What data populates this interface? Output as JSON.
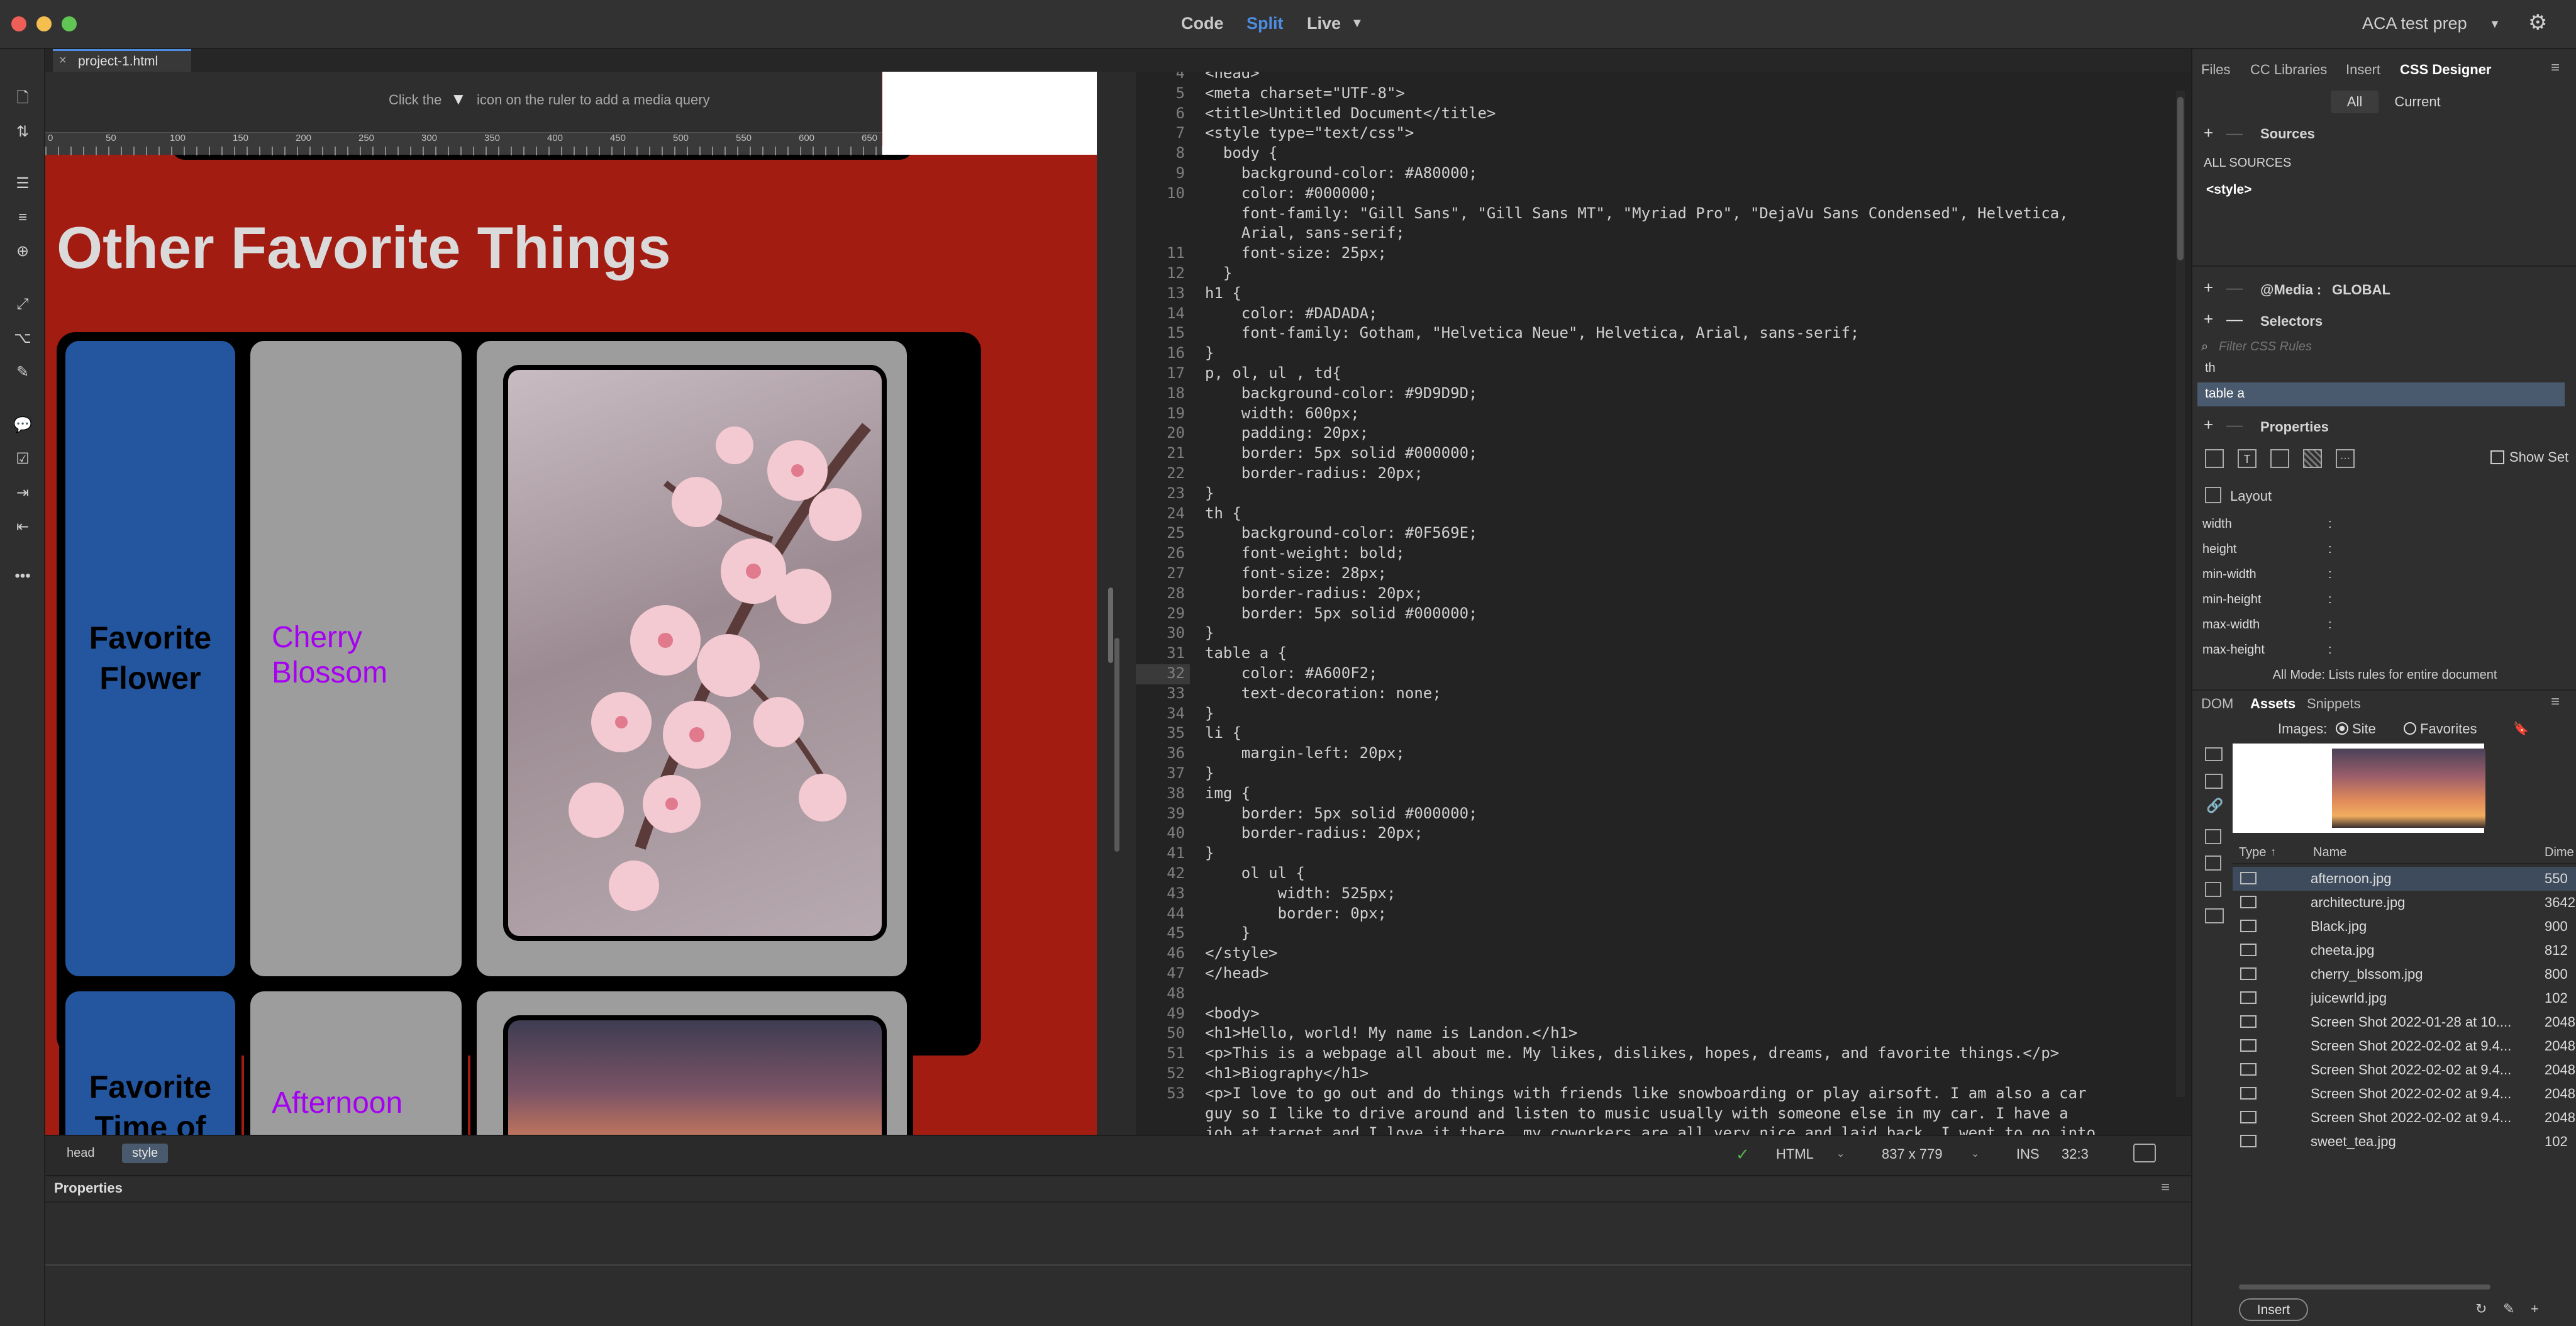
{
  "titlebar": {
    "views": [
      "Code",
      "Split",
      "Live"
    ],
    "active_view": "Split",
    "workspace": "ACA test prep"
  },
  "document_tab": {
    "filename": "project-1.html"
  },
  "design": {
    "media_query_hint_before": "Click the",
    "media_query_hint_after": "icon on the ruler to add a media query",
    "ruler_ticks": [
      "0",
      "50",
      "100",
      "150",
      "200",
      "250",
      "300",
      "350",
      "400",
      "450",
      "500",
      "550",
      "600",
      "650"
    ],
    "heading": "Other Favorite Things",
    "rows": [
      {
        "label": "Favorite Flower",
        "value": "Cherry Blossom"
      },
      {
        "label": "Favorite Time of",
        "value": "Afternoon"
      }
    ]
  },
  "code": {
    "lines": [
      {
        "n": "4",
        "t": "<head>"
      },
      {
        "n": "5",
        "t": "<meta charset=\"UTF-8\">"
      },
      {
        "n": "6",
        "t": "<title>Untitled Document</title>"
      },
      {
        "n": "7",
        "t": "<style type=\"text/css\">"
      },
      {
        "n": "8",
        "t": "  body {"
      },
      {
        "n": "9",
        "t": "    background-color: #A80000;"
      },
      {
        "n": "10",
        "t": "    color: #000000;"
      },
      {
        "n": "",
        "t": "    font-family: \"Gill Sans\", \"Gill Sans MT\", \"Myriad Pro\", \"DejaVu Sans Condensed\", Helvetica,"
      },
      {
        "n": "",
        "t": "    Arial, sans-serif;"
      },
      {
        "n": "11",
        "t": "    font-size: 25px;"
      },
      {
        "n": "12",
        "t": "  }"
      },
      {
        "n": "13",
        "t": "h1 {"
      },
      {
        "n": "14",
        "t": "    color: #DADADA;"
      },
      {
        "n": "15",
        "t": "    font-family: Gotham, \"Helvetica Neue\", Helvetica, Arial, sans-serif;"
      },
      {
        "n": "16",
        "t": "}"
      },
      {
        "n": "17",
        "t": "p, ol, ul , td{"
      },
      {
        "n": "18",
        "t": "    background-color: #9D9D9D;"
      },
      {
        "n": "19",
        "t": "    width: 600px;"
      },
      {
        "n": "20",
        "t": "    padding: 20px;"
      },
      {
        "n": "21",
        "t": "    border: 5px solid #000000;"
      },
      {
        "n": "22",
        "t": "    border-radius: 20px;"
      },
      {
        "n": "23",
        "t": "}"
      },
      {
        "n": "24",
        "t": "th {"
      },
      {
        "n": "25",
        "t": "    background-color: #0F569E;"
      },
      {
        "n": "26",
        "t": "    font-weight: bold;"
      },
      {
        "n": "27",
        "t": "    font-size: 28px;"
      },
      {
        "n": "28",
        "t": "    border-radius: 20px;"
      },
      {
        "n": "29",
        "t": "    border: 5px solid #000000;"
      },
      {
        "n": "30",
        "t": "}"
      },
      {
        "n": "31",
        "t": "table a {"
      },
      {
        "n": "32",
        "t": "    color: #A600F2;"
      },
      {
        "n": "33",
        "t": "    text-decoration: none;"
      },
      {
        "n": "34",
        "t": "}"
      },
      {
        "n": "35",
        "t": "li {"
      },
      {
        "n": "36",
        "t": "    margin-left: 20px;"
      },
      {
        "n": "37",
        "t": "}"
      },
      {
        "n": "38",
        "t": "img {"
      },
      {
        "n": "39",
        "t": "    border: 5px solid #000000;"
      },
      {
        "n": "40",
        "t": "    border-radius: 20px;"
      },
      {
        "n": "41",
        "t": "}"
      },
      {
        "n": "42",
        "t": "    ol ul {"
      },
      {
        "n": "43",
        "t": "        width: 525px;"
      },
      {
        "n": "44",
        "t": "        border: 0px;"
      },
      {
        "n": "45",
        "t": "    }"
      },
      {
        "n": "46",
        "t": "</style>"
      },
      {
        "n": "47",
        "t": "</head>"
      },
      {
        "n": "48",
        "t": ""
      },
      {
        "n": "49",
        "t": "<body>"
      },
      {
        "n": "50",
        "t": "<h1>Hello, world! My name is Landon.</h1>"
      },
      {
        "n": "51",
        "t": "<p>This is a webpage all about me. My likes, dislikes, hopes, dreams, and favorite things.</p>"
      },
      {
        "n": "52",
        "t": "<h1>Biography</h1>"
      },
      {
        "n": "53",
        "t": "<p>I love to go out and do things with friends like snowboarding or play airsoft. I am also a car"
      },
      {
        "n": "",
        "t": "guy so I like to drive around and listen to music usually with someone else in my car. I have a"
      },
      {
        "n": "",
        "t": "job at target and I love it there, my coworkers are all very nice and laid back. I went to go into"
      }
    ],
    "active_line": "32"
  },
  "statusbar": {
    "tags": [
      "head",
      "style"
    ],
    "language": "HTML",
    "dimensions": "837 x 779",
    "mode": "INS",
    "position": "32:3"
  },
  "properties": {
    "title": "Properties"
  },
  "rightpanel": {
    "tabs": [
      "Files",
      "CC Libraries",
      "Insert",
      "CSS Designer"
    ],
    "active_tab": "CSS Designer",
    "toggle": [
      "All",
      "Current"
    ],
    "sources_label": "Sources",
    "sources": [
      "ALL SOURCES",
      "<style>"
    ],
    "media_label": "@Media :",
    "media_value": "GLOBAL",
    "selectors_label": "Selectors",
    "filter_placeholder": "Filter CSS Rules",
    "selectors": [
      "th",
      "table a"
    ],
    "properties_label": "Properties",
    "show_set": "Show Set",
    "layout_label": "Layout",
    "layout_props": [
      "width",
      "height",
      "min-width",
      "min-height",
      "max-width",
      "max-height"
    ],
    "all_mode_note": "All Mode: Lists rules for entire document",
    "bottom_tabs": [
      "DOM",
      "Assets",
      "Snippets"
    ],
    "bottom_active": "Assets",
    "images_label": "Images:",
    "site_label": "Site",
    "favorites_label": "Favorites",
    "col_type": "Type",
    "col_name": "Name",
    "col_dim": "Dime",
    "assets": [
      {
        "name": "afternoon.jpg",
        "dim": "550"
      },
      {
        "name": "architecture.jpg",
        "dim": "3642"
      },
      {
        "name": "Black.jpg",
        "dim": "900"
      },
      {
        "name": "cheeta.jpg",
        "dim": "812"
      },
      {
        "name": "cherry_blssom.jpg",
        "dim": "800"
      },
      {
        "name": "juicewrld.jpg",
        "dim": "102"
      },
      {
        "name": "Screen Shot 2022-01-28 at 10....",
        "dim": "2048"
      },
      {
        "name": "Screen Shot 2022-02-02 at 9.4...",
        "dim": "2048"
      },
      {
        "name": "Screen Shot 2022-02-02 at 9.4...",
        "dim": "2048"
      },
      {
        "name": "Screen Shot 2022-02-02 at 9.4...",
        "dim": "2048"
      },
      {
        "name": "Screen Shot 2022-02-02 at 9.4...",
        "dim": "2048"
      },
      {
        "name": "sweet_tea.jpg",
        "dim": "102"
      }
    ],
    "insert_button": "Insert"
  },
  "colors": {
    "page_bg": "#A21C12",
    "th_bg": "#2456A0",
    "td_bg": "#9D9D9D",
    "link": "#A600F2",
    "h1": "#DADADA",
    "accent": "#4D8CE0"
  }
}
